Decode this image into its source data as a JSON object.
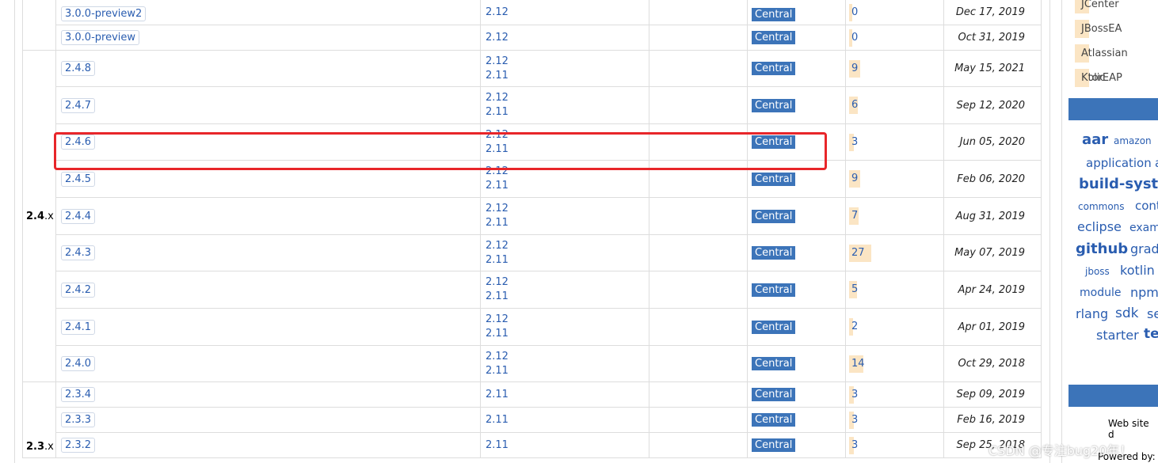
{
  "rows": [
    {
      "group": "",
      "version": "3.0.0-preview2",
      "scala": [
        "2.12"
      ],
      "repo": "Central",
      "usages": "0",
      "date": "Dec 17, 2019"
    },
    {
      "group": "",
      "version": "3.0.0-preview",
      "scala": [
        "2.12"
      ],
      "repo": "Central",
      "usages": "0",
      "date": "Oct 31, 2019"
    },
    {
      "group": "2.4.x",
      "version": "2.4.8",
      "scala": [
        "2.12",
        "2.11"
      ],
      "repo": "Central",
      "usages": "9",
      "date": "May 15, 2021"
    },
    {
      "group": "",
      "version": "2.4.7",
      "scala": [
        "2.12",
        "2.11"
      ],
      "repo": "Central",
      "usages": "6",
      "date": "Sep 12, 2020"
    },
    {
      "group": "",
      "version": "2.4.6",
      "scala": [
        "2.12",
        "2.11"
      ],
      "repo": "Central",
      "usages": "3",
      "date": "Jun 05, 2020"
    },
    {
      "group": "",
      "version": "2.4.5",
      "scala": [
        "2.12",
        "2.11"
      ],
      "repo": "Central",
      "usages": "9",
      "date": "Feb 06, 2020"
    },
    {
      "group": "",
      "version": "2.4.4",
      "scala": [
        "2.12",
        "2.11"
      ],
      "repo": "Central",
      "usages": "7",
      "date": "Aug 31, 2019"
    },
    {
      "group": "",
      "version": "2.4.3",
      "scala": [
        "2.12",
        "2.11"
      ],
      "repo": "Central",
      "usages": "27",
      "date": "May 07, 2019"
    },
    {
      "group": "",
      "version": "2.4.2",
      "scala": [
        "2.12",
        "2.11"
      ],
      "repo": "Central",
      "usages": "5",
      "date": "Apr 24, 2019"
    },
    {
      "group": "",
      "version": "2.4.1",
      "scala": [
        "2.12",
        "2.11"
      ],
      "repo": "Central",
      "usages": "2",
      "date": "Apr 01, 2019"
    },
    {
      "group": "",
      "version": "2.4.0",
      "scala": [
        "2.12",
        "2.11"
      ],
      "repo": "Central",
      "usages": "14",
      "date": "Oct 29, 2018"
    },
    {
      "group": "2.3.x",
      "version": "2.3.4",
      "scala": [
        "2.11"
      ],
      "repo": "Central",
      "usages": "3",
      "date": "Sep 09, 2019"
    },
    {
      "group": "",
      "version": "2.3.3",
      "scala": [
        "2.11"
      ],
      "repo": "Central",
      "usages": "3",
      "date": "Feb 16, 2019"
    },
    {
      "group": "",
      "version": "2.3.2",
      "scala": [
        "2.11"
      ],
      "repo": "Central",
      "usages": "3",
      "date": "Sep 25, 2018"
    }
  ],
  "group_24": {
    "major": "2.4",
    "suffix": ".x"
  },
  "group_23": {
    "major": "2.3",
    "suffix": ".x"
  },
  "sidebar": {
    "repositories": [
      "JCenter",
      "JBossEA",
      "Atlassian Public",
      "KtorEAP"
    ],
    "tags": [
      "aar",
      "amazon",
      "application",
      "a",
      "build-system",
      "commons",
      "cont",
      "eclipse",
      "exam",
      "github",
      "grad",
      "jboss",
      "kotlin",
      "module",
      "npm",
      "rlang",
      "sdk",
      "se",
      "starter",
      "tes"
    ],
    "website_text": "Web site d",
    "powered_text": "Powered by:"
  },
  "watermark": "CSDN @专注bug20年！",
  "colors": {
    "repo_badge": "#3c74b9",
    "usage_bar": "#fbe5c4",
    "link": "#2a5db0",
    "highlight": "#e8262a"
  }
}
